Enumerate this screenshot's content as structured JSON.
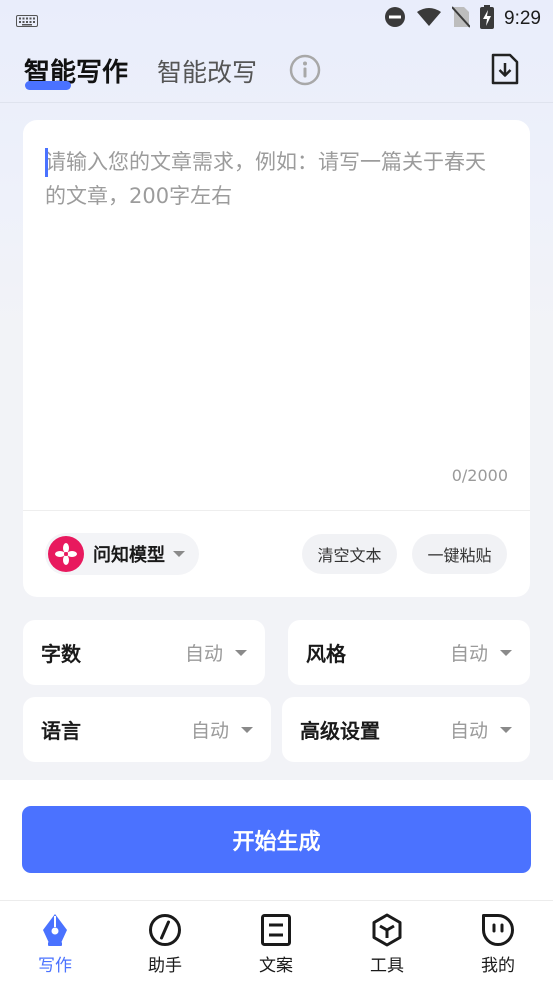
{
  "status_bar": {
    "time": "9:29"
  },
  "header": {
    "tab_active": "智能写作",
    "tab_inactive": "智能改写"
  },
  "editor": {
    "placeholder": "请输入您的文章需求，例如：请写一篇关于春天的文章，200字左右",
    "counter": "0/2000",
    "model_name": "问知模型",
    "clear_label": "清空文本",
    "paste_label": "一键粘贴"
  },
  "options": {
    "word_count": {
      "label": "字数",
      "value": "自动"
    },
    "style": {
      "label": "风格",
      "value": "自动"
    },
    "language": {
      "label": "语言",
      "value": "自动"
    },
    "advanced": {
      "label": "高级设置",
      "value": "自动"
    }
  },
  "generate_button": "开始生成",
  "nav": [
    {
      "label": "写作",
      "icon": "pen-nib-icon",
      "active": true
    },
    {
      "label": "助手",
      "icon": "compass-icon",
      "active": false
    },
    {
      "label": "文案",
      "icon": "document-icon",
      "active": false
    },
    {
      "label": "工具",
      "icon": "cube-icon",
      "active": false
    },
    {
      "label": "我的",
      "icon": "profile-face-icon",
      "active": false
    }
  ],
  "colors": {
    "accent": "#4a72ff",
    "model_logo": "#e8195e"
  }
}
